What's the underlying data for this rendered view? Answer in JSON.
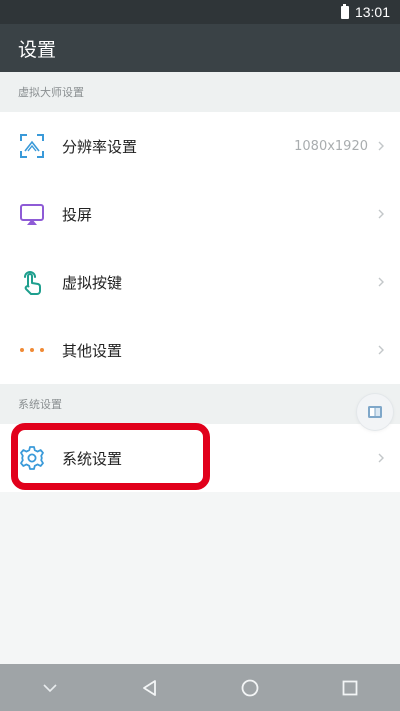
{
  "status_bar": {
    "time": "13:01"
  },
  "app_bar": {
    "title": "设置"
  },
  "sections": [
    {
      "header": "虚拟大师设置",
      "items": [
        {
          "label": "分辨率设置",
          "value": "1080x1920",
          "icon": "resolution-icon",
          "icon_color": "#3a9ad9"
        },
        {
          "label": "投屏",
          "value": "",
          "icon": "screen-cast-icon",
          "icon_color": "#8e5bd6"
        },
        {
          "label": "虚拟按键",
          "value": "",
          "icon": "touch-hand-icon",
          "icon_color": "#1e9f8e"
        },
        {
          "label": "其他设置",
          "value": "",
          "icon": "more-dots-icon",
          "icon_color": "#f08a35"
        }
      ]
    },
    {
      "header": "系统设置",
      "items": [
        {
          "label": "系统设置",
          "value": "",
          "icon": "gear-icon",
          "icon_color": "#3a9ad9"
        }
      ]
    }
  ],
  "highlight_color": "#e1001b"
}
